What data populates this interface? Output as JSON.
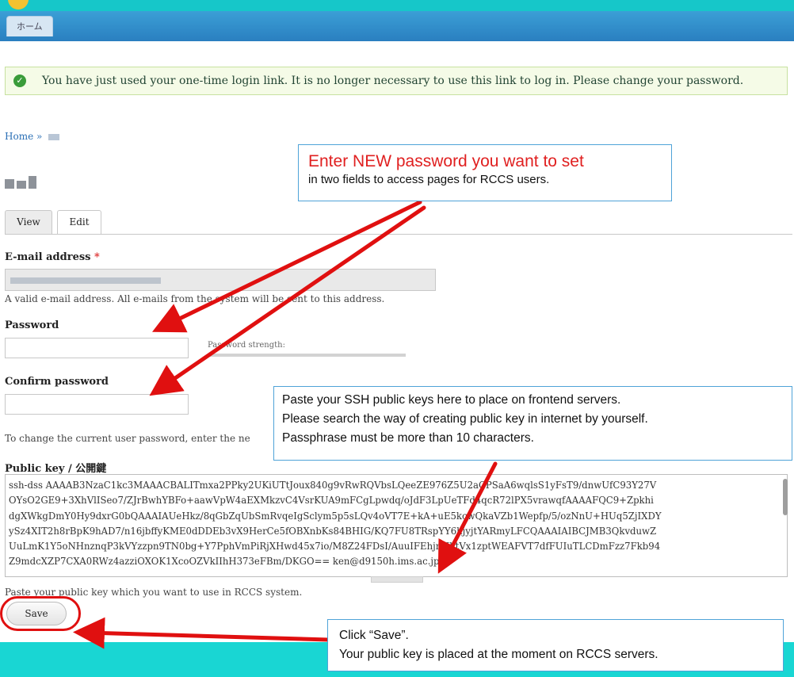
{
  "nav": {
    "home_tab": "ホーム"
  },
  "message": {
    "text": "You have just used your one-time login link. It is no longer necessary to use this link to log in. Please change your password."
  },
  "breadcrumb": {
    "home": "Home",
    "separator": "»"
  },
  "tabs": {
    "view": "View",
    "edit": "Edit"
  },
  "email": {
    "label": "E-mail address",
    "required": "*",
    "description": "A valid e-mail address. All e-mails from the system will be sent to this address."
  },
  "password": {
    "label": "Password",
    "strength_label": "Password strength:"
  },
  "confirm": {
    "label": "Confirm password",
    "description": "To change the current user password, enter the ne"
  },
  "public_key": {
    "label": "Public key / 公開鍵",
    "lines": [
      "ssh-dss AAAAB3NzaC1kc3MAAACBALITmxa2PPky2UKiUTtJoux840g9vRwRQVbsLQeeZE976Z5U2aCPSaA6wqlsS1yFsT9/dnwUfC93Y27V",
      "OYsO2GE9+3XhVlISeo7/ZJrBwhYBFo+aawVpW4aEXMkzvC4VsrKUA9mFCgLpwdq/oJdF3LpUeTFd4qcR72lPX5vrawqfAAAAFQC9+Zpkhi",
      "dgXWkgDmY0Hy9dxrG0bQAAAIAUeHkz/8qGbZqUbSmRvqeIgSclym5p5sLQv4oVT7E+kA+uE5kcwQkaVZb1Wepfp/5/ozNnU+HUq5ZjIXDY",
      "ySz4XIT2h8rBpK9hAD7/n16jbffyKME0dDDEb3vX9HerCe5fOBXnbKs84BHIG/KQ7FU8TRspYY6hjyjtYARmyLFCQAAAIAIBCJMB3QkvduwZ",
      "UuLmK1Y5oNHnznqP3kVYzzpn9TN0bg+Y7PphVmPiRjXHwd45x7io/M8Z24FDsI/AuuIFEhjnUhtVx1zptWEAFVT7dfFUIuTLCDmFzz7Fkb94",
      "Z9mdcXZP7CXA0RWz4azziOXOK1XcoOZVkIIhH373eFBm/DKGO== ken@d9150h.ims.ac.jp"
    ],
    "description": "Paste your public key which you want to use in RCCS system."
  },
  "save_label": "Save",
  "callouts": {
    "new_password": {
      "title_prefix": "Enter ",
      "title_new": "NEW",
      "title_suffix": " password you want to set",
      "sub": "in two fields to access pages for RCCS users."
    },
    "ssh": {
      "line1": "Paste your SSH public keys here to place on frontend servers.",
      "line2": "Please search the way of creating public key in internet by yourself.",
      "line3": "Passphrase must be more than 10 characters."
    },
    "save": {
      "line1": "Click “Save”.",
      "line2": "Your public key is placed at the moment on RCCS servers."
    }
  },
  "colors": {
    "accent_red": "#e01010",
    "callout_border": "#4fa3d8",
    "nav_blue": "#2a7fc0",
    "footer_teal": "#19d6d3"
  }
}
